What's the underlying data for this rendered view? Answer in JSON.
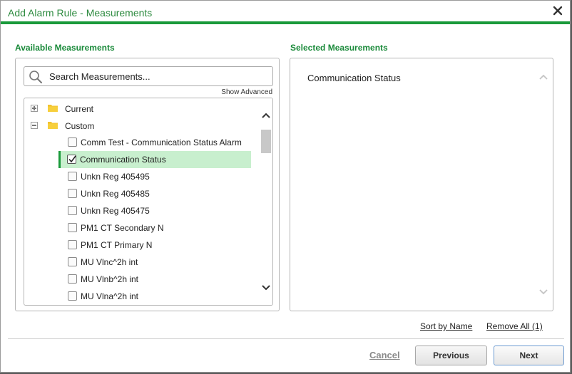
{
  "dialog": {
    "title": "Add Alarm Rule - Measurements",
    "close_icon": "close-icon",
    "accent_color": "#1a9a3b"
  },
  "available": {
    "heading": "Available Measurements",
    "search_placeholder": "Search Measurements...",
    "search_icon": "search-icon",
    "show_advanced": "Show Advanced",
    "folders": [
      {
        "label": "Current",
        "expanded": false
      },
      {
        "label": "Custom",
        "expanded": true
      }
    ],
    "items": [
      {
        "label": "Comm Test - Communication Status Alarm",
        "checked": false
      },
      {
        "label": "Communication Status",
        "checked": true
      },
      {
        "label": "Unkn Reg 405495",
        "checked": false
      },
      {
        "label": "Unkn Reg 405485",
        "checked": false
      },
      {
        "label": "Unkn Reg 405475",
        "checked": false
      },
      {
        "label": "PM1 CT Secondary N",
        "checked": false
      },
      {
        "label": "PM1 CT Primary N",
        "checked": false
      },
      {
        "label": "MU Vlnc^2h int",
        "checked": false
      },
      {
        "label": "MU Vlnb^2h int",
        "checked": false
      },
      {
        "label": "MU Vlna^2h int",
        "checked": false
      }
    ]
  },
  "selected": {
    "heading": "Selected Measurements",
    "items": [
      "Communication Status"
    ],
    "sort_by_name": "Sort by Name",
    "remove_all": "Remove All (1)"
  },
  "footer": {
    "cancel": "Cancel",
    "previous": "Previous",
    "next": "Next"
  }
}
